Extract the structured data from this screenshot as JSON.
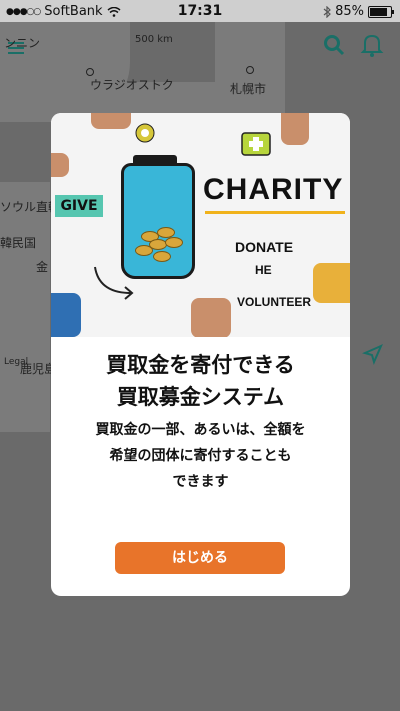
{
  "status_bar": {
    "carrier": "SoftBank",
    "time": "17:31",
    "battery": "85%",
    "signal_dots": "●●●○○"
  },
  "map": {
    "scale": "500 km",
    "labels": {
      "top_left": "ンニン",
      "vladivostok": "ウラジオストク",
      "sapporo": "札幌市",
      "korea_north": "ソウル直轄",
      "korea_south": "韓民国",
      "kagoshima": "鹿児島",
      "gold": "金",
      "legal": "Legal"
    }
  },
  "modal": {
    "hero_words": {
      "charity": "CHARITY",
      "give": "GIVE",
      "donate": "DONATE",
      "help": "HE",
      "volunteer": "VOLUNTEER"
    },
    "title_line1": "買取金を寄付できる",
    "title_line2": "買取募金システム",
    "desc_line1": "買取金の一部、あるいは、全額を",
    "desc_line2": "希望の団体に寄付することも",
    "desc_line3": "できます",
    "button_label": "はじめる"
  },
  "colors": {
    "accent_teal": "#1a6f67",
    "button_orange": "#e8742a",
    "jar_blue": "#39b6d8"
  },
  "icons": [
    "menu-icon",
    "search-icon",
    "bell-icon",
    "location-arrow-icon",
    "wifi-icon",
    "bluetooth-icon",
    "battery-icon"
  ]
}
